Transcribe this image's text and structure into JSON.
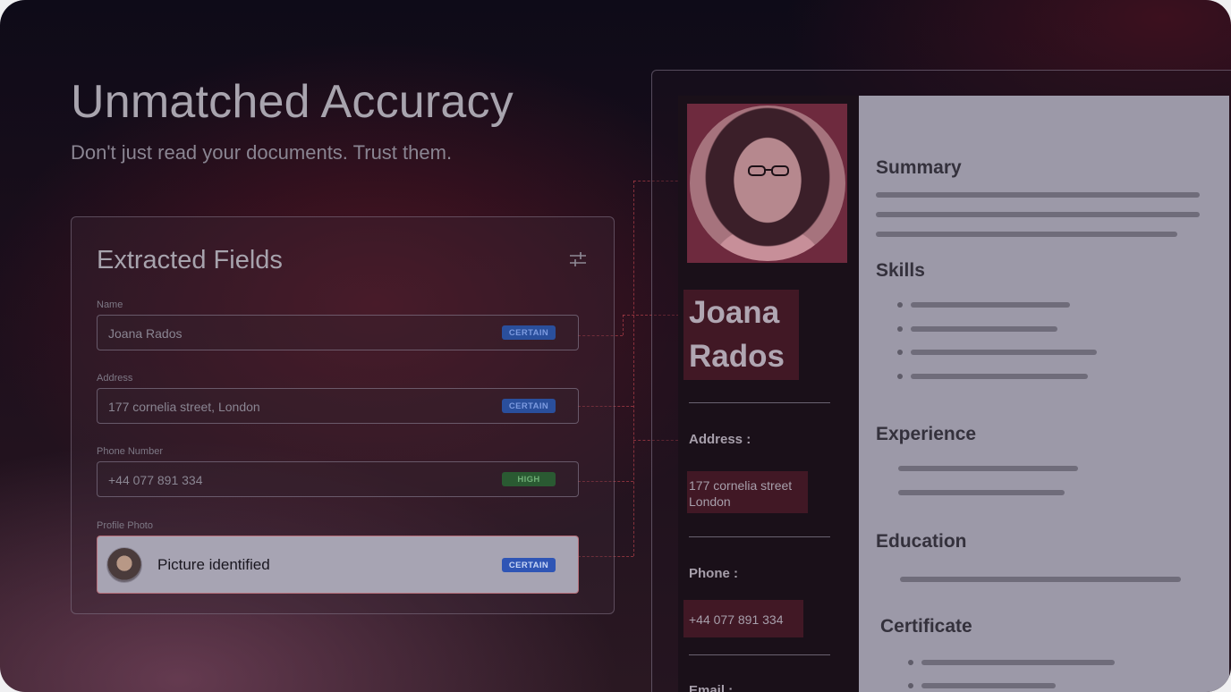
{
  "hero": {
    "title": "Unmatched Accuracy",
    "subtitle": "Don't just read your documents. Trust them."
  },
  "panel": {
    "title": "Extracted Fields",
    "settings_icon": "sliders-icon",
    "fields": [
      {
        "label": "Name",
        "value": "Joana Rados",
        "confidence": "CERTAIN"
      },
      {
        "label": "Address",
        "value": "177 cornelia street, London",
        "confidence": "CERTAIN"
      },
      {
        "label": "Phone Number",
        "value": "+44 077 891 334",
        "confidence": "HIGH"
      }
    ],
    "photo": {
      "label": "Profile Photo",
      "value": "Picture identified",
      "confidence": "CERTAIN"
    }
  },
  "resume": {
    "first_name": "Joana",
    "last_name": "Rados",
    "address_label": "Address :",
    "address_line1": "177 cornelia street",
    "address_line2": "London",
    "phone_label": "Phone :",
    "phone_value": "+44 077 891 334",
    "email_label": "Email :",
    "sections": {
      "summary": "Summary",
      "skills": "Skills",
      "experience": "Experience",
      "education": "Education",
      "certificate": "Certificate"
    }
  },
  "colors": {
    "certain_badge": "#2a4f9c",
    "high_badge": "#2a5a32",
    "highlight": "#6e2a3e",
    "doc_right_bg": "#9c99a8"
  }
}
